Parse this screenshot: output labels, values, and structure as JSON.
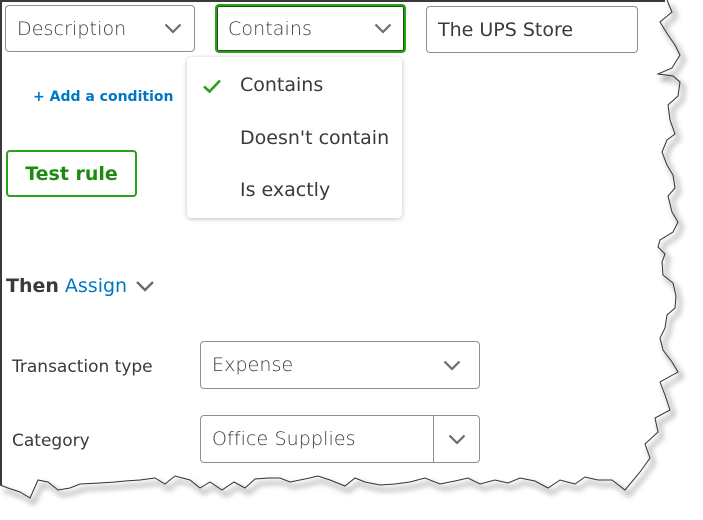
{
  "condition": {
    "field": "Description",
    "operator": "Contains",
    "value": "The UPS Store"
  },
  "operator_dropdown": {
    "options": [
      {
        "label": "Contains",
        "selected": true
      },
      {
        "label": "Doesn't contain",
        "selected": false
      },
      {
        "label": "Is exactly",
        "selected": false
      }
    ]
  },
  "add_condition_label": "+ Add a condition",
  "test_rule_label": "Test rule",
  "then": {
    "prefix": "Then",
    "action": "Assign"
  },
  "assign_fields": {
    "transaction_type": {
      "label": "Transaction type",
      "value": "Expense"
    },
    "category": {
      "label": "Category",
      "value": "Office Supplies"
    }
  },
  "colors": {
    "accent_green": "#2ca01c",
    "link_blue": "#0077c5",
    "text": "#393a3d",
    "border": "#8d9096"
  },
  "icons": {
    "chevron": "chevron-down-icon",
    "check": "check-icon"
  }
}
